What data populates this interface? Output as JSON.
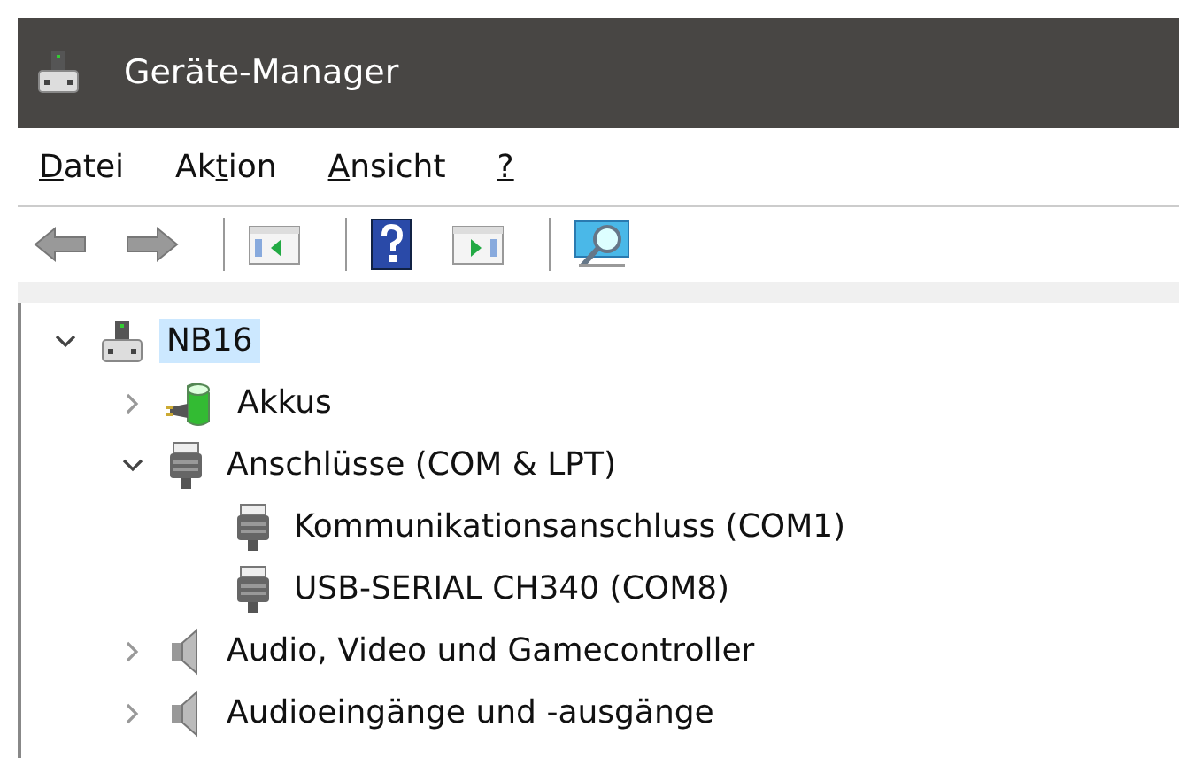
{
  "window": {
    "title": "Geräte-Manager"
  },
  "menu": [
    {
      "key": "D",
      "after": "atei"
    },
    {
      "before": "Ak",
      "key": "t",
      "after": "ion"
    },
    {
      "key": "A",
      "after": "nsicht"
    },
    {
      "key": "?"
    }
  ],
  "toolbar": [
    {
      "kind": "back",
      "disabled": true
    },
    {
      "kind": "forward",
      "disabled": true
    },
    {
      "kind": "separator"
    },
    {
      "kind": "pane-left",
      "disabled": false
    },
    {
      "kind": "separator"
    },
    {
      "kind": "help",
      "disabled": false
    },
    {
      "kind": "pane-right",
      "disabled": false
    },
    {
      "kind": "separator"
    },
    {
      "kind": "scan",
      "disabled": false
    }
  ],
  "tree": [
    {
      "label": "NB16",
      "kind": "computer",
      "expanded": true,
      "selected": true,
      "children": [
        {
          "label": "Akkus",
          "kind": "battery",
          "expanded": false,
          "selected": false
        },
        {
          "label": "Anschlüsse (COM & LPT)",
          "kind": "port",
          "expanded": true,
          "selected": false,
          "children": [
            {
              "label": "Kommunikationsanschluss (COM1)",
              "kind": "port",
              "selected": false
            },
            {
              "label": "USB-SERIAL CH340 (COM8)",
              "kind": "port",
              "selected": false
            }
          ]
        },
        {
          "label": "Audio, Video und Gamecontroller",
          "kind": "speaker",
          "expanded": false,
          "selected": false
        },
        {
          "label": "Audioeingänge und -ausgänge",
          "kind": "speaker",
          "expanded": false,
          "selected": false
        }
      ]
    }
  ]
}
